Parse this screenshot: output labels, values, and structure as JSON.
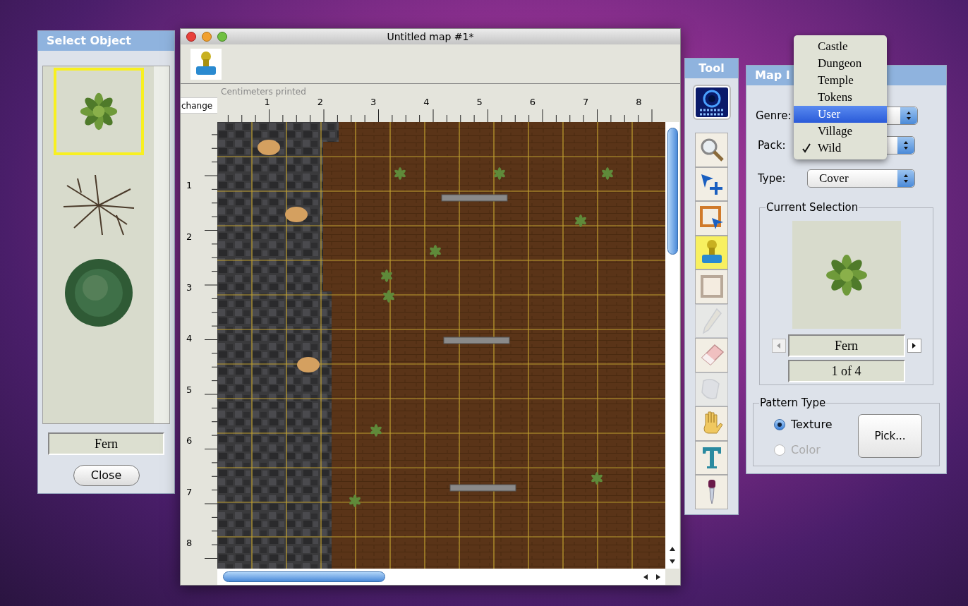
{
  "select_object": {
    "title": "Select Object",
    "items": [
      {
        "kind": "fern",
        "selected": true
      },
      {
        "kind": "dead-bush",
        "selected": false
      },
      {
        "kind": "bush",
        "selected": false
      }
    ],
    "name_field": "Fern",
    "close_button": "Close"
  },
  "map_window": {
    "title": "Untitled map #1*",
    "change_button": "change",
    "ruler_caption": "Centimeters printed",
    "h_ruler": [
      "1",
      "2",
      "3",
      "4",
      "5",
      "6",
      "7",
      "8"
    ],
    "v_ruler": [
      "1",
      "2",
      "3",
      "4",
      "5",
      "6",
      "7",
      "8"
    ]
  },
  "tool_palette": {
    "title": "Tool",
    "tools": [
      {
        "kind": "web",
        "selected": false,
        "disabled": false
      },
      {
        "kind": "zoom",
        "selected": false,
        "disabled": false
      },
      {
        "kind": "add",
        "selected": false,
        "disabled": false
      },
      {
        "kind": "select",
        "selected": false,
        "disabled": false
      },
      {
        "kind": "stamp",
        "selected": true,
        "disabled": false
      },
      {
        "kind": "frame",
        "selected": false,
        "disabled": false
      },
      {
        "kind": "pencil",
        "selected": false,
        "disabled": true
      },
      {
        "kind": "eraser",
        "selected": false,
        "disabled": false
      },
      {
        "kind": "fill",
        "selected": false,
        "disabled": true
      },
      {
        "kind": "hand",
        "selected": false,
        "disabled": false
      },
      {
        "kind": "text",
        "selected": false,
        "disabled": false
      },
      {
        "kind": "dropper",
        "selected": false,
        "disabled": false
      }
    ]
  },
  "map_info": {
    "title": "Map I",
    "genre_label": "Genre:",
    "pack_label": "Pack:",
    "type_label": "Type:",
    "type_value": "Cover",
    "current_selection": {
      "title": "Current Selection",
      "name": "Fern",
      "count": "1 of 4"
    },
    "pattern_type": {
      "title": "Pattern Type",
      "options": [
        {
          "label": "Texture",
          "selected": true,
          "disabled": false
        },
        {
          "label": "Color",
          "selected": false,
          "disabled": true
        }
      ],
      "pick_button": "Pick..."
    }
  },
  "genre_menu": {
    "items": [
      {
        "label": "Castle",
        "selected": false,
        "checked": false
      },
      {
        "label": "Dungeon",
        "selected": false,
        "checked": false
      },
      {
        "label": "Temple",
        "selected": false,
        "checked": false
      },
      {
        "label": "Tokens",
        "selected": false,
        "checked": false
      },
      {
        "label": "User",
        "selected": true,
        "checked": false
      },
      {
        "label": "Village",
        "selected": false,
        "checked": false
      },
      {
        "label": "Wild",
        "selected": false,
        "checked": true
      }
    ]
  }
}
